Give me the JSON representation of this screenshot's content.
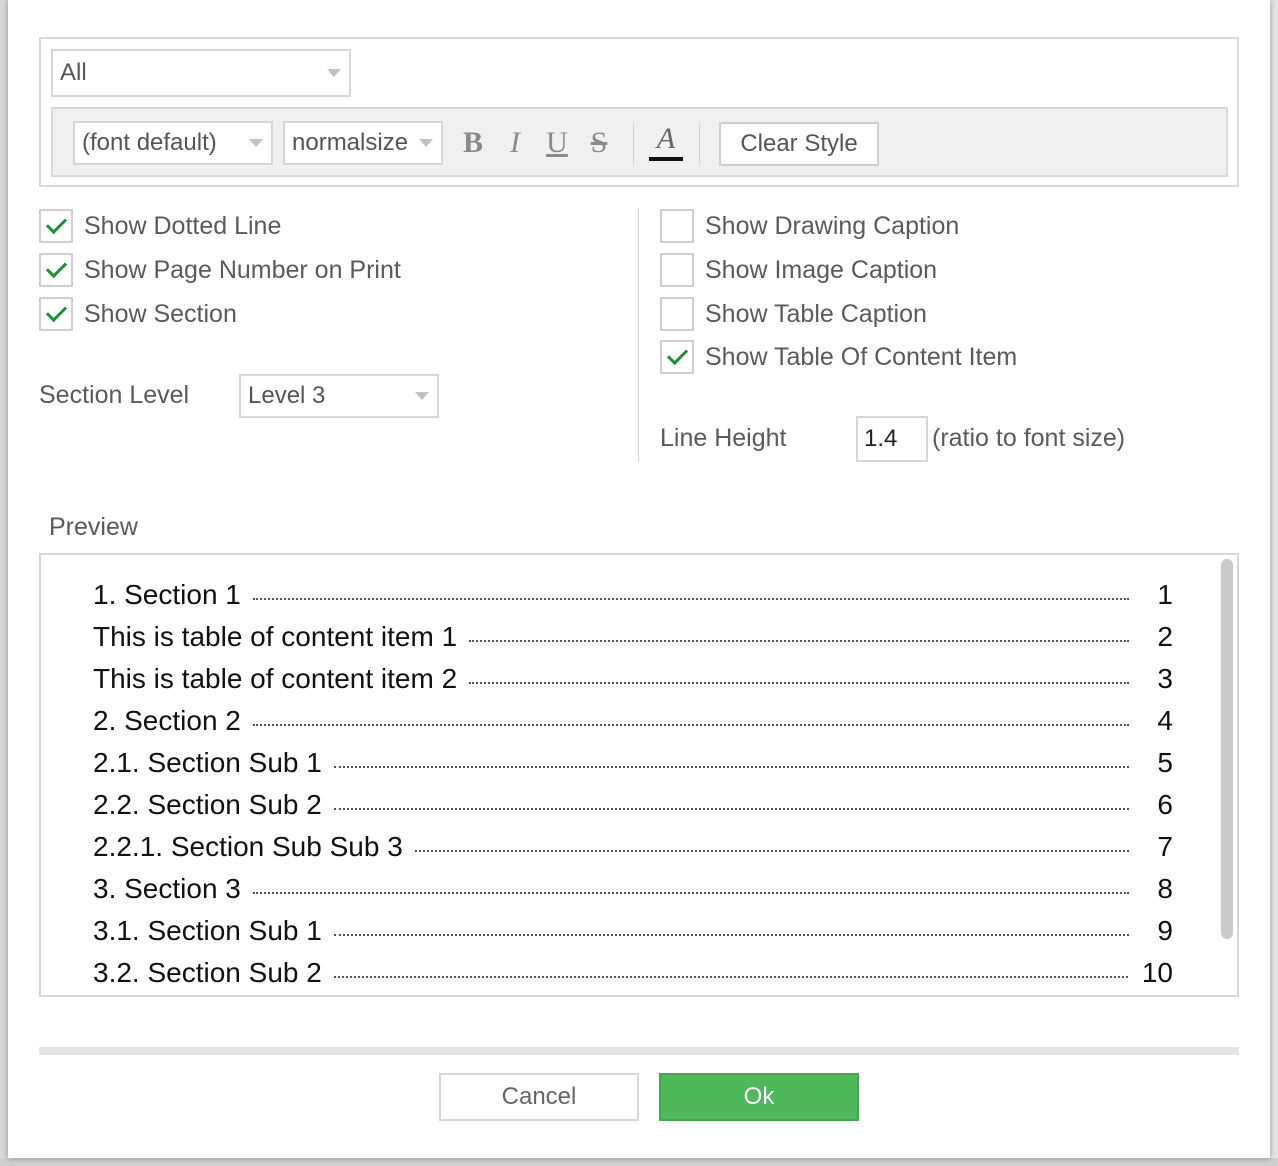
{
  "style": {
    "target": "All",
    "font": "(font default)",
    "size": "normalsize",
    "bold": "B",
    "italic": "I",
    "underline": "U",
    "strike": "S",
    "color": "A",
    "clear_label": "Clear Style"
  },
  "options_left": [
    {
      "label": "Show Dotted Line",
      "checked": true
    },
    {
      "label": "Show Page Number on Print",
      "checked": true
    },
    {
      "label": "Show Section",
      "checked": true
    }
  ],
  "options_right": [
    {
      "label": "Show Drawing Caption",
      "checked": false
    },
    {
      "label": "Show Image Caption",
      "checked": false
    },
    {
      "label": "Show Table Caption",
      "checked": false
    },
    {
      "label": "Show Table Of Content Item",
      "checked": true
    }
  ],
  "section_level": {
    "label": "Section Level",
    "value": "Level 3"
  },
  "line_height": {
    "label": "Line Height",
    "value": "1.4",
    "hint": "(ratio to font size)"
  },
  "preview": {
    "label": "Preview",
    "items": [
      {
        "title": "1. Section 1",
        "page": "1"
      },
      {
        "title": "This is table of content item 1",
        "page": "2"
      },
      {
        "title": "This is table of content item 2",
        "page": "3"
      },
      {
        "title": "2. Section 2",
        "page": "4"
      },
      {
        "title": "2.1. Section Sub 1",
        "page": "5"
      },
      {
        "title": "2.2. Section Sub 2",
        "page": "6"
      },
      {
        "title": "2.2.1. Section Sub Sub 3",
        "page": "7"
      },
      {
        "title": "3. Section 3",
        "page": "8"
      },
      {
        "title": "3.1. Section Sub 1",
        "page": "9"
      },
      {
        "title": "3.2. Section Sub 2",
        "page": "10"
      }
    ]
  },
  "buttons": {
    "cancel": "Cancel",
    "ok": "Ok"
  },
  "colors": {
    "accent": "#4eb85a",
    "check": "#1f8f3a"
  }
}
